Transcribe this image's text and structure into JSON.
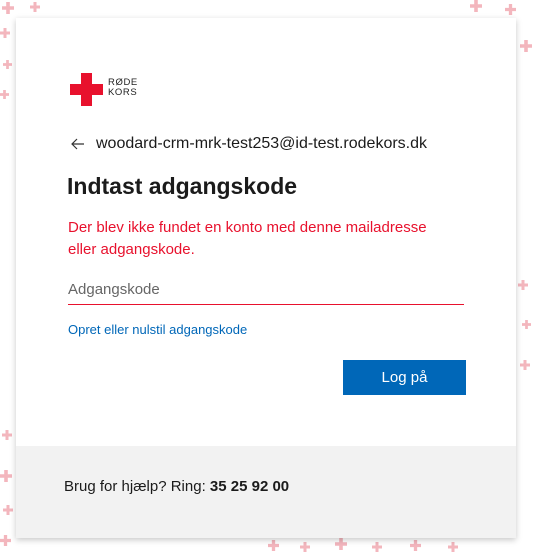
{
  "brand": {
    "logo_text_line1": "RØDE",
    "logo_text_line2": "KORS",
    "cross_color": "#e8112d"
  },
  "identity": {
    "back_icon": "back-arrow-icon",
    "email": "woodard-crm-mrk-test253@id-test.rodekors.dk"
  },
  "title": "Indtast adgangskode",
  "error_message": "Der blev ikke fundet en konto med denne mailadresse eller adgangskode.",
  "password": {
    "placeholder": "Adgangskode",
    "value": ""
  },
  "reset_link": "Opret eller nulstil adgangskode",
  "signin_button": "Log på",
  "footer": {
    "help_label": "Brug for hjælp? Ring: ",
    "phone": "35 25 92 00"
  },
  "colors": {
    "accent": "#0067b8",
    "error": "#e8112d",
    "footer_bg": "#f2f2f2"
  }
}
